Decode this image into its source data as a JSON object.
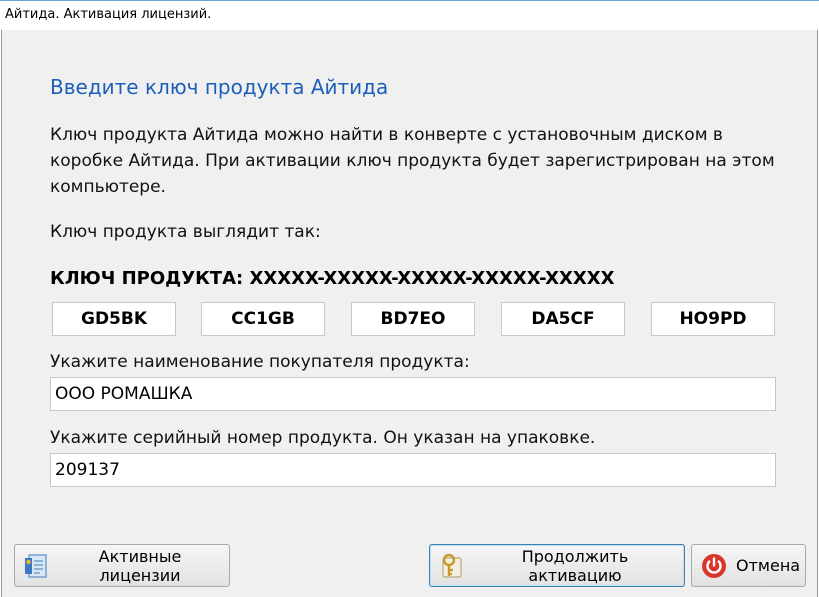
{
  "window": {
    "title": "Айтида. Активация лицензий."
  },
  "heading": "Введите ключ продукта Айтида",
  "description": "Ключ продукта Айтида можно найти в конверте с установочным диском в коробке Айтида. При активации ключ продукта будет зарегистрирован на этом компьютере.",
  "key_example_label": "Ключ продукта выглядит так:",
  "key_format": "КЛЮЧ ПРОДУКТА: XXXXX-XXXXX-XXXXX-XXXXX-XXXXX",
  "key_parts": [
    "GD5BK",
    "CC1GB",
    "BD7EO",
    "DA5CF",
    "HO9PD"
  ],
  "buyer": {
    "label": "Укажите наименование покупателя продукта:",
    "value": "ООО РОМАШКА"
  },
  "serial": {
    "label": "Укажите серийный номер продукта. Он указан на упаковке.",
    "value": "209137"
  },
  "buttons": {
    "active_licenses": "Активные лицензии",
    "continue": "Продолжить активацию",
    "cancel": "Отмена"
  },
  "colors": {
    "heading": "#1d5fb8",
    "cancel_icon": "#d9352b"
  }
}
